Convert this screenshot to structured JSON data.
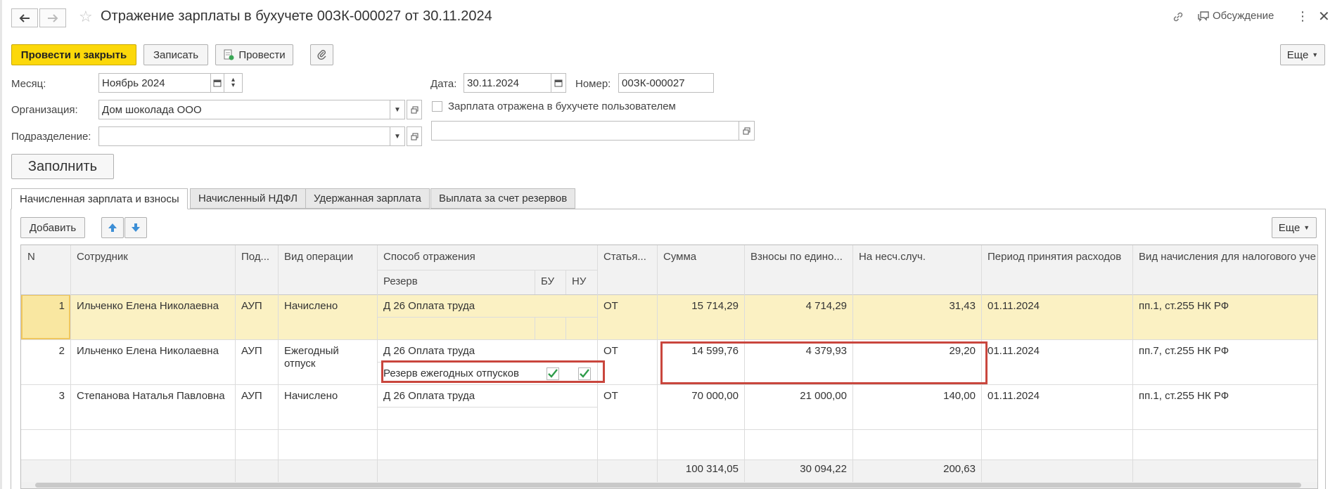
{
  "window": {
    "title": "Отражение зарплаты в бухучете 00ЗК-000027 от 30.11.2024",
    "discussion_label": "Обсуждение"
  },
  "toolbar": {
    "post_close": "Провести и закрыть",
    "save": "Записать",
    "post": "Провести",
    "more": "Еще"
  },
  "form": {
    "month_label": "Месяц:",
    "month_value": "Ноябрь 2024",
    "date_label": "Дата:",
    "date_value": "30.11.2024",
    "number_label": "Номер:",
    "number_value": "00ЗК-000027",
    "org_label": "Организация:",
    "org_value": "Дом шоколада ООО",
    "dept_label": "Подразделение:",
    "dept_value": "",
    "reflected_label": "Зарплата отражена в бухучете пользователем",
    "fill_button": "Заполнить"
  },
  "tabs": [
    {
      "label": "Начисленная зарплата и взносы",
      "active": true
    },
    {
      "label": "Начисленный НДФЛ",
      "active": false
    },
    {
      "label": "Удержанная зарплата",
      "active": false
    },
    {
      "label": "Выплата за счет резервов",
      "active": false
    }
  ],
  "table_toolbar": {
    "add": "Добавить",
    "more": "Еще"
  },
  "table": {
    "columns": {
      "n": "N",
      "employee": "Сотрудник",
      "dept": "Под...",
      "operation": "Вид операции",
      "method": "Способ отражения",
      "reserve": "Резерв",
      "bu": "БУ",
      "nu": "НУ",
      "article": "Статья...",
      "sum": "Сумма",
      "contrib": "Взносы по едино...",
      "accident": "На несч.случ.",
      "period": "Период принятия расходов",
      "tax_type": "Вид начисления для налогового уче"
    },
    "rows": [
      {
        "n": "1",
        "employee": "Ильченко Елена Николаевна",
        "dept": "АУП",
        "operation_1": "Начислено",
        "operation_2": "",
        "method": "Д 26 Оплата труда",
        "reserve": "",
        "bu": false,
        "nu": false,
        "article": "ОТ",
        "sum": "15 714,29",
        "contrib": "4 714,29",
        "accident": "31,43",
        "period": "01.11.2024",
        "tax_type": "пп.1, ст.255 НК РФ"
      },
      {
        "n": "2",
        "employee": "Ильченко Елена Николаевна",
        "dept": "АУП",
        "operation_1": "Ежегодный",
        "operation_2": "отпуск",
        "method": "Д 26 Оплата труда",
        "reserve": "Резерв ежегодных отпусков",
        "bu": true,
        "nu": true,
        "article": "ОТ",
        "sum": "14 599,76",
        "contrib": "4 379,93",
        "accident": "29,20",
        "period": "01.11.2024",
        "tax_type": "пп.7, ст.255 НК РФ"
      },
      {
        "n": "3",
        "employee": "Степанова Наталья Павловна",
        "dept": "АУП",
        "operation_1": "Начислено",
        "operation_2": "",
        "method": "Д 26 Оплата труда",
        "reserve": "",
        "bu": false,
        "nu": false,
        "article": "ОТ",
        "sum": "70 000,00",
        "contrib": "21 000,00",
        "accident": "140,00",
        "period": "01.11.2024",
        "tax_type": "пп.1, ст.255 НК РФ"
      }
    ],
    "totals": {
      "sum": "100 314,05",
      "contrib": "30 094,22",
      "accident": "200,63"
    }
  },
  "colors": {
    "primary_button": "#fcd80a",
    "selected_row": "#fbf1c3",
    "highlight_box": "#c9463d",
    "check_green": "#2e9c4a",
    "arrow_blue": "#3d8fd6"
  }
}
